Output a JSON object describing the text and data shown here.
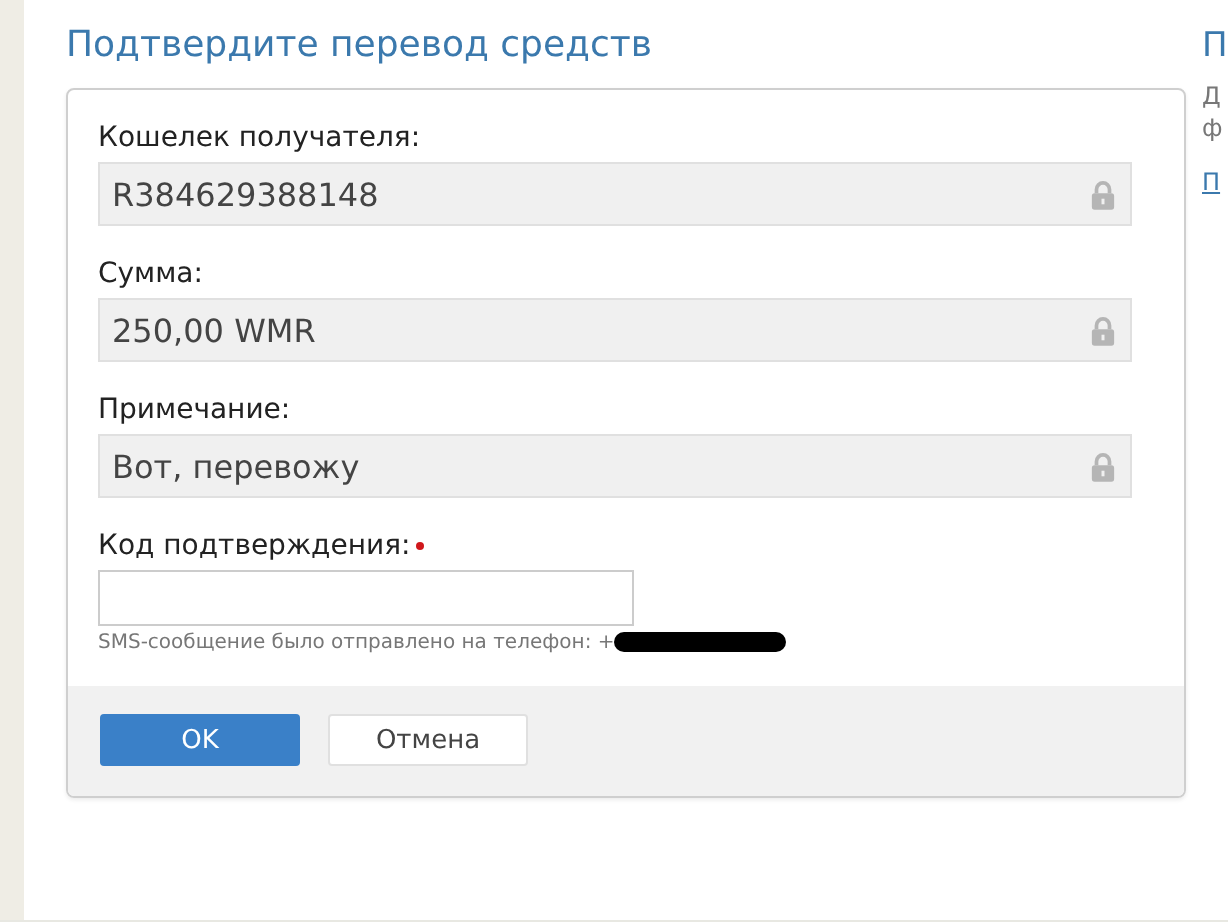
{
  "title": "Подтвердите перевод средств",
  "fields": [
    {
      "kind": "locked",
      "label": "Кошелек получателя:",
      "value": "R384629388148",
      "required": false
    },
    {
      "kind": "locked",
      "label": "Сумма:",
      "value": "250,00 WMR",
      "required": false
    },
    {
      "kind": "locked",
      "label": "Примечание:",
      "value": "Вот, перевожу",
      "required": false
    },
    {
      "kind": "input",
      "label": "Код подтверждения:",
      "required": true,
      "hint": "SMS-сообщение было отправлено на телефон: +"
    }
  ],
  "buttons": [
    {
      "label": "OK",
      "primary": true
    },
    {
      "label": "Отмена",
      "primary": false
    }
  ],
  "side": {
    "title": "П",
    "lines": [
      "Д",
      "ф"
    ],
    "link": "П"
  }
}
